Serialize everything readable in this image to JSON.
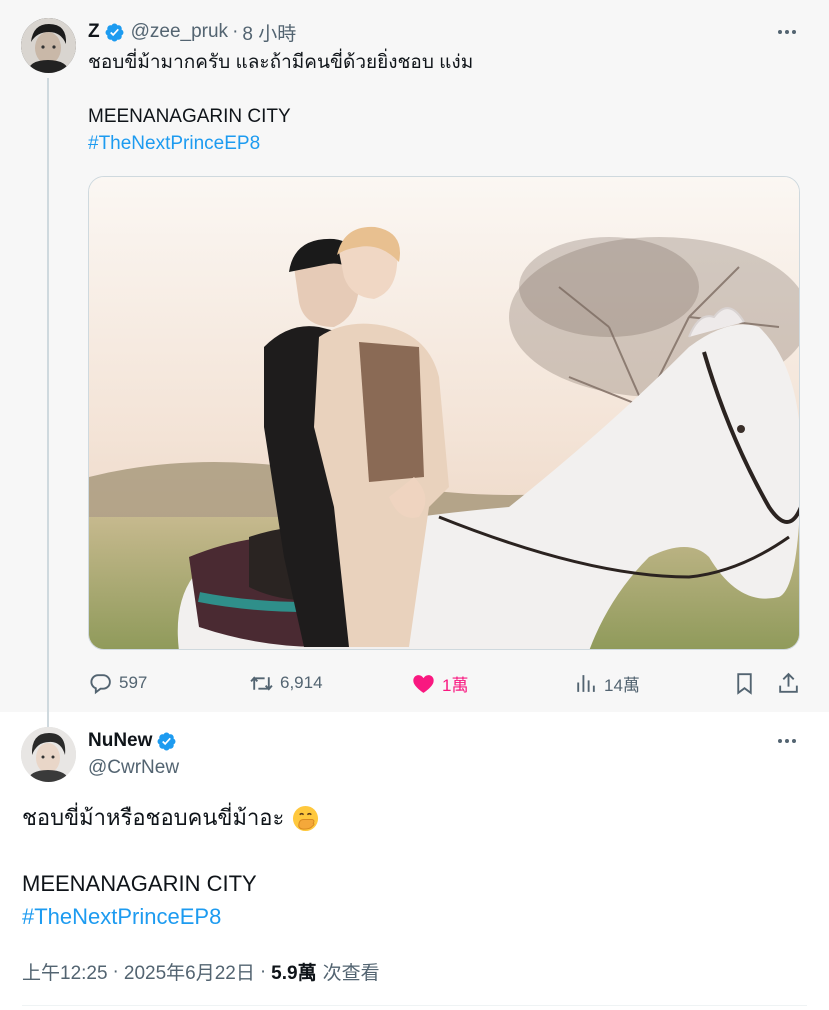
{
  "parent_tweet": {
    "name": "Z",
    "handle": "@zee_pruk",
    "separator": "·",
    "time": "8 小時",
    "text_line1": "ชอบขี่ม้ามากครับ และถ้ามีคนขี่ด้วยยิ่งชอบ แง่ม",
    "text_line2": "MEENANAGARIN CITY",
    "hashtag": "#TheNextPrinceEP8",
    "stats": {
      "replies": "597",
      "retweets": "6,914",
      "likes": "1萬",
      "views": "14萬"
    },
    "liked": true
  },
  "main_tweet": {
    "name": "NuNew",
    "handle": "@CwrNew",
    "text_line1": "ชอบขี่ม้าหรือชอบคนขี่ม้าอะ",
    "emoji": "face-with-hand-over-mouth",
    "text_line2": "MEENANAGARIN CITY",
    "hashtag": "#TheNextPrinceEP8",
    "time": "上午12:25",
    "separator": "·",
    "date": "2025年6月22日",
    "views_count": "5.9萬",
    "views_label": "次查看"
  },
  "colors": {
    "link": "#1d9bf0",
    "verified": "#1d9bf0",
    "like": "#f91880",
    "secondary_text": "#536471",
    "thread_line": "#cfd9de"
  },
  "icons": [
    "reply-icon",
    "retweet-icon",
    "heart-icon",
    "views-icon",
    "bookmark-icon",
    "share-icon",
    "more-icon",
    "verified-badge-icon"
  ]
}
